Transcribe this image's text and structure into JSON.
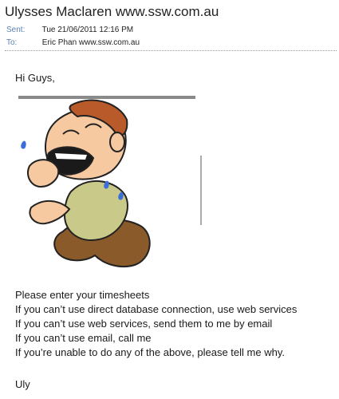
{
  "header": {
    "sender": "Ulysses Maclaren www.ssw.com.au",
    "sent_label": "Sent:",
    "sent_value": "Tue 21/06/2011 12:16 PM",
    "to_label": "To:",
    "to_value": "Eric Phan www.ssw.com.au"
  },
  "body": {
    "greeting": "Hi Guys,",
    "image": "crying-man-cartoon",
    "lines": [
      "Please enter your timesheets",
      "If you can’t use direct database connection, use web services",
      "If you can’t use web services, send them to me by email",
      "If you can’t use email, call me",
      "If you’re unable to do any of the above, please tell me why."
    ],
    "signoff": "Uly"
  },
  "colors": {
    "label_blue": "#5b7fb5",
    "skin": "#f6c9a0",
    "hair": "#b85a2a",
    "shirt": "#c9c98a",
    "pants": "#8a5a2a"
  }
}
